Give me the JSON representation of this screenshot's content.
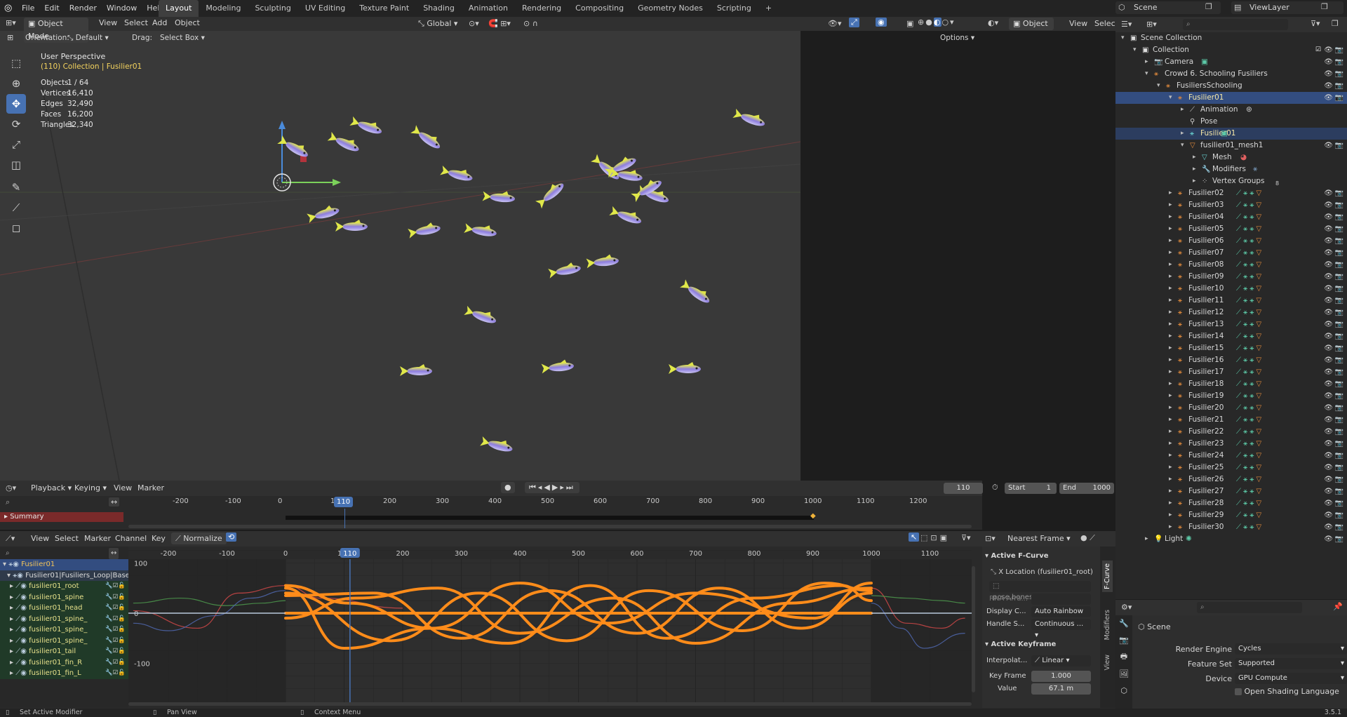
{
  "topbar": {
    "menus": [
      "File",
      "Edit",
      "Render",
      "Window",
      "Help"
    ],
    "workspaces": [
      "Layout",
      "Modeling",
      "Sculpting",
      "UV Editing",
      "Texture Paint",
      "Shading",
      "Animation",
      "Rendering",
      "Compositing",
      "Geometry Nodes",
      "Scripting"
    ],
    "active_workspace": "Layout",
    "add_tab": "+",
    "scene": "Scene",
    "view_layer": "ViewLayer"
  },
  "viewport_header": {
    "mode": "Object Mode",
    "menus": [
      "View",
      "Select",
      "Add",
      "Object"
    ],
    "transform_orientation": "Global",
    "orientation_label": "Orientation:",
    "orientation_value": "Default",
    "drag_label": "Drag:",
    "drag_value": "Select Box",
    "options": "Options"
  },
  "viewport_overlay": {
    "title": "User Perspective",
    "subtitle": "(110) Collection | Fusilier01",
    "stats": [
      {
        "label": "Objects",
        "value": "1 / 64"
      },
      {
        "label": "Vertices",
        "value": "16,410"
      },
      {
        "label": "Edges",
        "value": "32,490"
      },
      {
        "label": "Faces",
        "value": "16,200"
      },
      {
        "label": "Triangles",
        "value": "32,340"
      }
    ],
    "gizmo": {
      "z": "Z",
      "x": "X",
      "y": "Y"
    }
  },
  "properties_header_small": {
    "mode": "Object",
    "view": "View",
    "select": "Selec"
  },
  "timeline": {
    "menus": [
      "Playback",
      "Keying",
      "View",
      "Marker"
    ],
    "current_frame": "110",
    "start_label": "Start",
    "start": "1",
    "end_label": "End",
    "end": "1000",
    "ticks": [
      "-200",
      "-100",
      "0",
      "100",
      "200",
      "300",
      "400",
      "500",
      "600",
      "700",
      "800",
      "900",
      "1000",
      "1100",
      "1200"
    ],
    "summary": "Summary"
  },
  "graph_editor": {
    "menus": [
      "View",
      "Select",
      "Marker",
      "Channel",
      "Key"
    ],
    "normalize": "Normalize",
    "pivot": "Nearest Frame",
    "ticks": [
      "-200",
      "-100",
      "0",
      "100",
      "200",
      "300",
      "400",
      "500",
      "600",
      "700",
      "800",
      "900",
      "1000",
      "1100"
    ],
    "current_frame": "110",
    "y_labels": [
      "100",
      "0",
      "-100"
    ],
    "channels": [
      {
        "name": "Fusilier01",
        "type": "object"
      },
      {
        "name": "Fusilier01|Fusiliers_Loop|BaseLa",
        "type": "action"
      },
      {
        "name": "fusilier01_root",
        "type": "group"
      },
      {
        "name": "fusilier01_spine",
        "type": "group"
      },
      {
        "name": "fusilier01_head",
        "type": "group"
      },
      {
        "name": "fusilier01_spine_",
        "type": "group"
      },
      {
        "name": "fusilier01_spine_",
        "type": "group"
      },
      {
        "name": "fusilier01_spine_",
        "type": "group"
      },
      {
        "name": "fusilier01_tail",
        "type": "group"
      },
      {
        "name": "fusilier01_fin_R",
        "type": "group"
      },
      {
        "name": "fusilier01_fin_L",
        "type": "group"
      }
    ],
    "sidebar": {
      "active_fcurve_title": "Active F-Curve",
      "fcurve_name": "X Location (fusilier01_root)",
      "data_path": "pose.bones...ot\"].location",
      "rna_array_label": "RNA Arra...",
      "display_color_label": "Display C...",
      "display_color_value": "Auto Rainbow",
      "handle_smoothing_label": "Handle S...",
      "handle_smoothing_value": "Continuous ...",
      "active_keyframe_title": "Active Keyframe",
      "interpolation_label": "Interpolat...",
      "interpolation_value": "Linear",
      "key_frame_label": "Key Frame",
      "key_frame_value": "1.000",
      "value_label": "Value",
      "value_value": "67.1 m",
      "tabs": [
        "F-Curve",
        "Modifiers",
        "View"
      ]
    }
  },
  "outliner": {
    "items": [
      {
        "label": "Scene Collection",
        "indent": 0,
        "icon": "collection"
      },
      {
        "label": "Collection",
        "indent": 1,
        "icon": "collection"
      },
      {
        "label": "Camera",
        "indent": 2,
        "icon": "camera"
      },
      {
        "label": "Crowd 6. Schooling Fusiliers",
        "indent": 2,
        "icon": "armature"
      },
      {
        "label": "FusiliersSchooling",
        "indent": 3,
        "icon": "armature"
      },
      {
        "label": "Fusilier01",
        "indent": 4,
        "icon": "armature"
      },
      {
        "label": "Animation",
        "indent": 5,
        "icon": "animation"
      },
      {
        "label": "Pose",
        "indent": 5,
        "icon": "pose"
      },
      {
        "label": "Fusilier01",
        "indent": 5,
        "icon": "armature-data"
      },
      {
        "label": "fusilier01_mesh1",
        "indent": 5,
        "icon": "mesh"
      },
      {
        "label": "Mesh",
        "indent": 6,
        "icon": "mesh-data"
      },
      {
        "label": "Modifiers",
        "indent": 6,
        "icon": "wrench"
      },
      {
        "label": "Vertex Groups",
        "indent": 6,
        "icon": "vertex-groups"
      },
      {
        "label": "Fusilier02",
        "indent": 4,
        "icon": "armature"
      },
      {
        "label": "Fusilier03",
        "indent": 4,
        "icon": "armature"
      },
      {
        "label": "Fusilier04",
        "indent": 4,
        "icon": "armature"
      },
      {
        "label": "Fusilier05",
        "indent": 4,
        "icon": "armature"
      },
      {
        "label": "Fusilier06",
        "indent": 4,
        "icon": "armature"
      },
      {
        "label": "Fusilier07",
        "indent": 4,
        "icon": "armature"
      },
      {
        "label": "Fusilier08",
        "indent": 4,
        "icon": "armature"
      },
      {
        "label": "Fusilier09",
        "indent": 4,
        "icon": "armature"
      },
      {
        "label": "Fusilier10",
        "indent": 4,
        "icon": "armature"
      },
      {
        "label": "Fusilier11",
        "indent": 4,
        "icon": "armature"
      },
      {
        "label": "Fusilier12",
        "indent": 4,
        "icon": "armature"
      },
      {
        "label": "Fusilier13",
        "indent": 4,
        "icon": "armature"
      },
      {
        "label": "Fusilier14",
        "indent": 4,
        "icon": "armature"
      },
      {
        "label": "Fusilier15",
        "indent": 4,
        "icon": "armature"
      },
      {
        "label": "Fusilier16",
        "indent": 4,
        "icon": "armature"
      },
      {
        "label": "Fusilier17",
        "indent": 4,
        "icon": "armature"
      },
      {
        "label": "Fusilier18",
        "indent": 4,
        "icon": "armature"
      },
      {
        "label": "Fusilier19",
        "indent": 4,
        "icon": "armature"
      },
      {
        "label": "Fusilier20",
        "indent": 4,
        "icon": "armature"
      },
      {
        "label": "Fusilier21",
        "indent": 4,
        "icon": "armature"
      },
      {
        "label": "Fusilier22",
        "indent": 4,
        "icon": "armature"
      },
      {
        "label": "Fusilier23",
        "indent": 4,
        "icon": "armature"
      },
      {
        "label": "Fusilier24",
        "indent": 4,
        "icon": "armature"
      },
      {
        "label": "Fusilier25",
        "indent": 4,
        "icon": "armature"
      },
      {
        "label": "Fusilier26",
        "indent": 4,
        "icon": "armature"
      },
      {
        "label": "Fusilier27",
        "indent": 4,
        "icon": "armature"
      },
      {
        "label": "Fusilier28",
        "indent": 4,
        "icon": "armature"
      },
      {
        "label": "Fusilier29",
        "indent": 4,
        "icon": "armature"
      },
      {
        "label": "Fusilier30",
        "indent": 4,
        "icon": "armature"
      },
      {
        "label": "Light",
        "indent": 2,
        "icon": "light"
      }
    ],
    "vertex_group_count": "8"
  },
  "properties": {
    "scene_label": "Scene",
    "render_engine_label": "Render Engine",
    "render_engine": "Cycles",
    "feature_set_label": "Feature Set",
    "feature_set": "Supported",
    "device_label": "Device",
    "device": "GPU Compute",
    "osl_label": "Open Shading Language"
  },
  "statusbar": {
    "items": [
      "Set Active Modifier",
      "Pan View",
      "Context Menu"
    ],
    "version": "3.5.1"
  },
  "colors": {
    "accent": "#4772b3",
    "curve_orange": "#ff8c1a",
    "selected_row": "#334d80"
  }
}
